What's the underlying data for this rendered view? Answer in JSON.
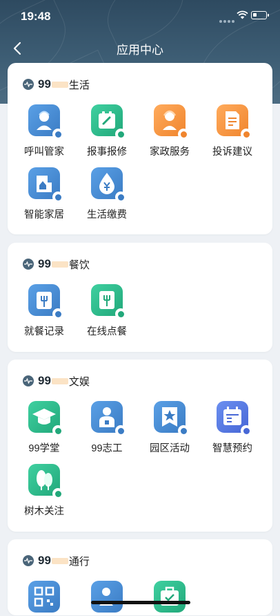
{
  "status_bar": {
    "time": "19:48"
  },
  "nav": {
    "title": "应用中心"
  },
  "sections": [
    {
      "brand": "99",
      "name": "生活",
      "apps": [
        {
          "label": "呼叫管家",
          "icon": "butler-icon",
          "color": "#4a8fd6"
        },
        {
          "label": "报事报修",
          "icon": "repair-icon",
          "color": "#2fbf8f"
        },
        {
          "label": "家政服务",
          "icon": "housekeeping-icon",
          "color": "#f59a45"
        },
        {
          "label": "投诉建议",
          "icon": "complaint-icon",
          "color": "#f59a45"
        },
        {
          "label": "智能家居",
          "icon": "smart-home-icon",
          "color": "#4a8fd6"
        },
        {
          "label": "生活缴费",
          "icon": "payment-icon",
          "color": "#4a8fd6"
        }
      ]
    },
    {
      "brand": "99",
      "name": "餐饮",
      "apps": [
        {
          "label": "就餐记录",
          "icon": "dining-record-icon",
          "color": "#4a8fd6"
        },
        {
          "label": "在线点餐",
          "icon": "order-food-icon",
          "color": "#2fbf8f"
        }
      ]
    },
    {
      "brand": "99",
      "name": "文娱",
      "apps": [
        {
          "label": "99学堂",
          "icon": "graduation-cap-icon",
          "color": "#2fbf8f"
        },
        {
          "label": "99志工",
          "icon": "volunteer-icon",
          "color": "#4a8fd6"
        },
        {
          "label": "园区活动",
          "icon": "star-badge-icon",
          "color": "#4a8fd6"
        },
        {
          "label": "智慧预约",
          "icon": "calendar-icon",
          "color": "#4a8fd6"
        },
        {
          "label": "树木关注",
          "icon": "tree-icon",
          "color": "#2fbf8f"
        }
      ]
    },
    {
      "brand": "99",
      "name": "通行",
      "apps": [
        {
          "label": "",
          "icon": "qr-code-icon",
          "color": "#4a8fd6"
        },
        {
          "label": "",
          "icon": "visitor-icon",
          "color": "#4a8fd6"
        },
        {
          "label": "",
          "icon": "pass-icon",
          "color": "#2fbf8f"
        }
      ]
    }
  ]
}
